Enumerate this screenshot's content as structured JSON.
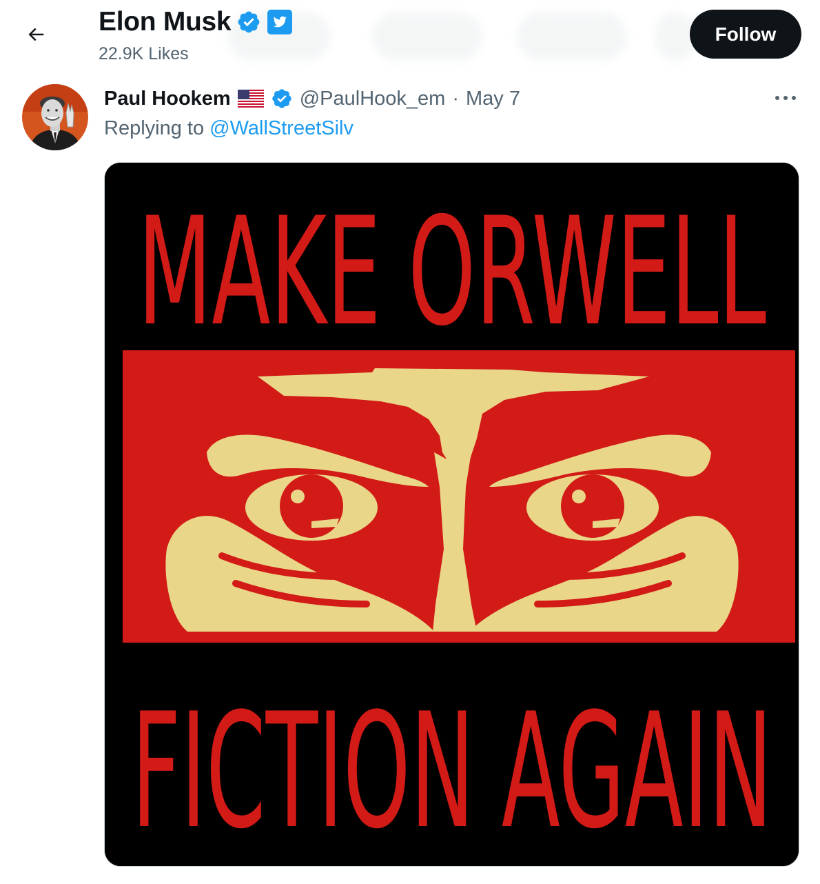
{
  "header": {
    "profile_name": "Elon Musk",
    "likes": "22.9K Likes",
    "follow_label": "Follow",
    "icons": {
      "back": "arrow-left-icon",
      "verified": "verified-badge-icon",
      "twitter": "twitter-bird-icon"
    }
  },
  "tweet": {
    "author_name": "Paul Hookem",
    "handle": "@PaulHook_em",
    "separator": "·",
    "date": "May 7",
    "replying_prefix": "Replying to",
    "replying_to": "@WallStreetSilv",
    "icons": {
      "flag": "us-flag-icon",
      "verified": "verified-badge-icon",
      "more": "more-options-icon"
    },
    "media": {
      "top_text": "MAKE ORWELL",
      "bottom_text": "FICTION AGAIN",
      "colors": {
        "background": "#000000",
        "red": "#d21a16",
        "cream": "#e9d689"
      }
    }
  },
  "colors": {
    "accent": "#1d9bf0",
    "text": "#0f1419",
    "muted": "#536471"
  }
}
